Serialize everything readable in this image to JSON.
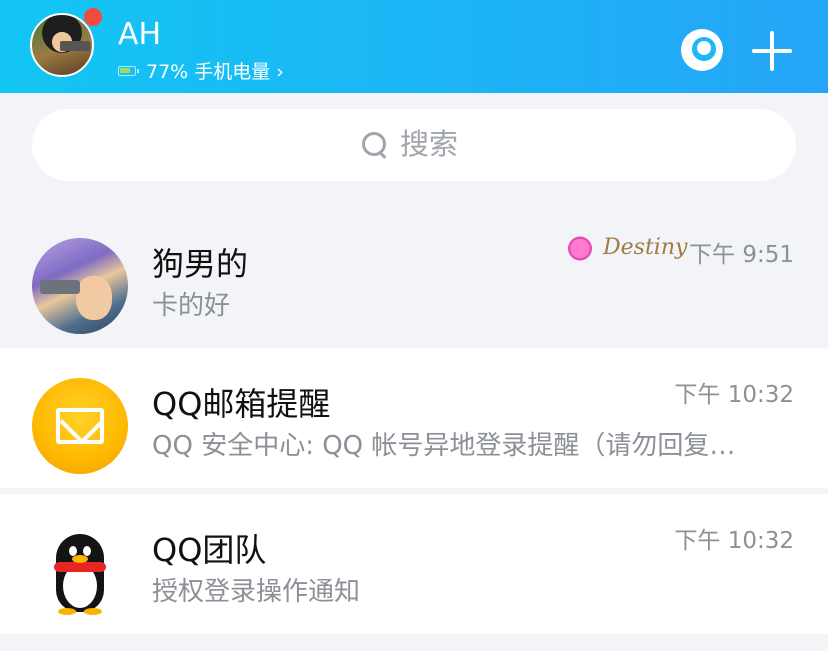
{
  "header": {
    "username": "AH",
    "battery_text": "77% 手机电量 ›",
    "colors": {
      "gradient_start": "#13c6f3",
      "gradient_end": "#25a5f6",
      "notification_dot": "#f24b3c"
    },
    "icons": [
      "moon-icon",
      "plus-icon"
    ]
  },
  "search": {
    "placeholder": "搜索"
  },
  "conversations": [
    {
      "name": "狗男的",
      "preview": "卡的好",
      "time": "下午 9:51",
      "badge_text": "Destiny",
      "pinned": true
    },
    {
      "name": "QQ邮箱提醒",
      "preview": "QQ 安全中心: QQ 帐号异地登录提醒（请勿回复…",
      "time": "下午 10:32",
      "pinned": false
    },
    {
      "name": "QQ团队",
      "preview": "授权登录操作通知",
      "time": "下午 10:32",
      "pinned": false
    }
  ]
}
